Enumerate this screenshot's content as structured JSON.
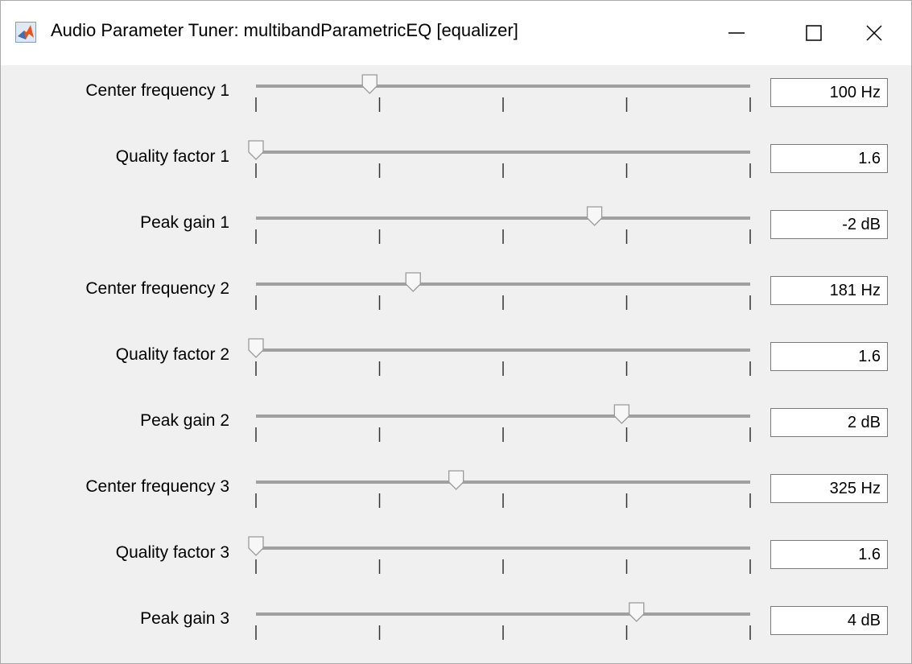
{
  "window": {
    "title": "Audio Parameter Tuner: multibandParametricEQ [equalizer]",
    "icon": "matlab-icon",
    "controls": {
      "minimize": "minimize-icon",
      "maximize": "maximize-icon",
      "close": "close-icon"
    }
  },
  "parameters": [
    {
      "label": "Center frequency 1",
      "value": "100 Hz",
      "slider_position": 0.23
    },
    {
      "label": "Quality factor 1",
      "value": "1.6",
      "slider_position": 0.0
    },
    {
      "label": "Peak gain 1",
      "value": "-2 dB",
      "slider_position": 0.685
    },
    {
      "label": "Center frequency 2",
      "value": "181 Hz",
      "slider_position": 0.318
    },
    {
      "label": "Quality factor 2",
      "value": "1.6",
      "slider_position": 0.0
    },
    {
      "label": "Peak gain 2",
      "value": "2 dB",
      "slider_position": 0.74
    },
    {
      "label": "Center frequency 3",
      "value": "325 Hz",
      "slider_position": 0.405
    },
    {
      "label": "Quality factor 3",
      "value": "1.6",
      "slider_position": 0.0
    },
    {
      "label": "Peak gain 3",
      "value": "4 dB",
      "slider_position": 0.77
    }
  ],
  "colors": {
    "background": "#f0f0f0",
    "titlebar": "#ffffff",
    "track": "#a0a0a0",
    "tick": "#333333",
    "thumb_fill": "#f7f7f7",
    "thumb_stroke": "#9a9a9a"
  }
}
